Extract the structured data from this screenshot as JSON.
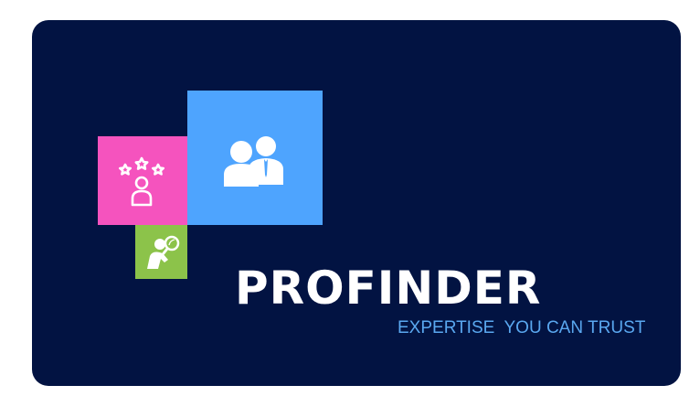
{
  "logo": {
    "brand_name": "PROFINDER",
    "tagline": "EXPERTISE  YOU CAN TRUST",
    "tiles": [
      {
        "icon": "rated-expert-icon",
        "color": "#f553be"
      },
      {
        "icon": "professionals-icon",
        "color": "#4ea4fe"
      },
      {
        "icon": "search-person-icon",
        "color": "#8cc34a"
      }
    ]
  },
  "colors": {
    "background": "#021342",
    "page": "#ffffff",
    "brand_text": "#ffffff",
    "tagline_text": "#5aa8f0"
  }
}
